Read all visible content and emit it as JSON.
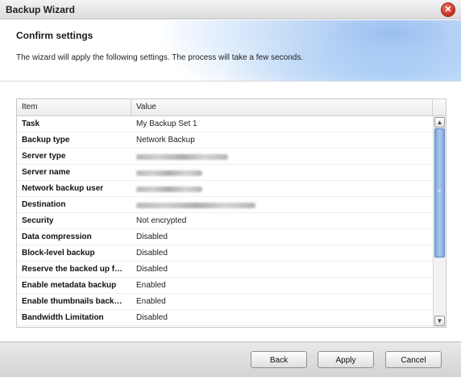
{
  "window": {
    "title": "Backup Wizard"
  },
  "header": {
    "title": "Confirm settings",
    "description": "The wizard will apply the following settings. The process will take a few seconds."
  },
  "table": {
    "columns": [
      "Item",
      "Value"
    ],
    "rows": [
      {
        "item": "Task",
        "value": "My Backup Set 1"
      },
      {
        "item": "Backup type",
        "value": "Network Backup"
      },
      {
        "item": "Server type",
        "value": ""
      },
      {
        "item": "Server name",
        "value": ""
      },
      {
        "item": "Network backup user",
        "value": ""
      },
      {
        "item": "Destination",
        "value": ""
      },
      {
        "item": "Security",
        "value": "Not encrypted"
      },
      {
        "item": "Data compression",
        "value": "Disabled"
      },
      {
        "item": "Block-level backup",
        "value": "Disabled"
      },
      {
        "item": "Reserve the backed up f…",
        "value": "Disabled"
      },
      {
        "item": "Enable metadata backup",
        "value": "Enabled"
      },
      {
        "item": "Enable thumbnails back…",
        "value": "Enabled"
      },
      {
        "item": "Bandwidth Limitation",
        "value": "Disabled"
      }
    ]
  },
  "buttons": {
    "back": "Back",
    "apply": "Apply",
    "cancel": "Cancel"
  },
  "icons": {
    "close": "close-icon",
    "scroll_up": "chevron-up-icon",
    "scroll_down": "chevron-down-icon"
  }
}
